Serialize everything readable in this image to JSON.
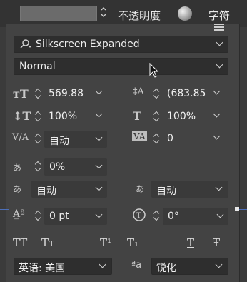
{
  "topbar": {
    "opacity_label": "不透明度",
    "character_label": "字符"
  },
  "font": {
    "family": "Silkscreen Expanded",
    "style": "Normal"
  },
  "fields": {
    "size": "569.88",
    "leading": "(683.85",
    "vertical_scale": "100%",
    "horizontal_scale": "100%",
    "kerning": "自动",
    "tracking": "0",
    "tsume": "0%",
    "aki_left": "自动",
    "aki_right": "自动",
    "baseline_shift": "0 pt",
    "rotation": "0°"
  },
  "bottom": {
    "language": "英语: 美国",
    "antialias": "锐化",
    "antialias_prefix": "ªa"
  },
  "format_buttons": [
    "TT",
    "Tт",
    "T¹",
    "T₁",
    "T",
    "Ŧ"
  ],
  "icons": [
    "color-swatch",
    "sphere-icon",
    "panel-menu-icon",
    "font-search-icon"
  ]
}
